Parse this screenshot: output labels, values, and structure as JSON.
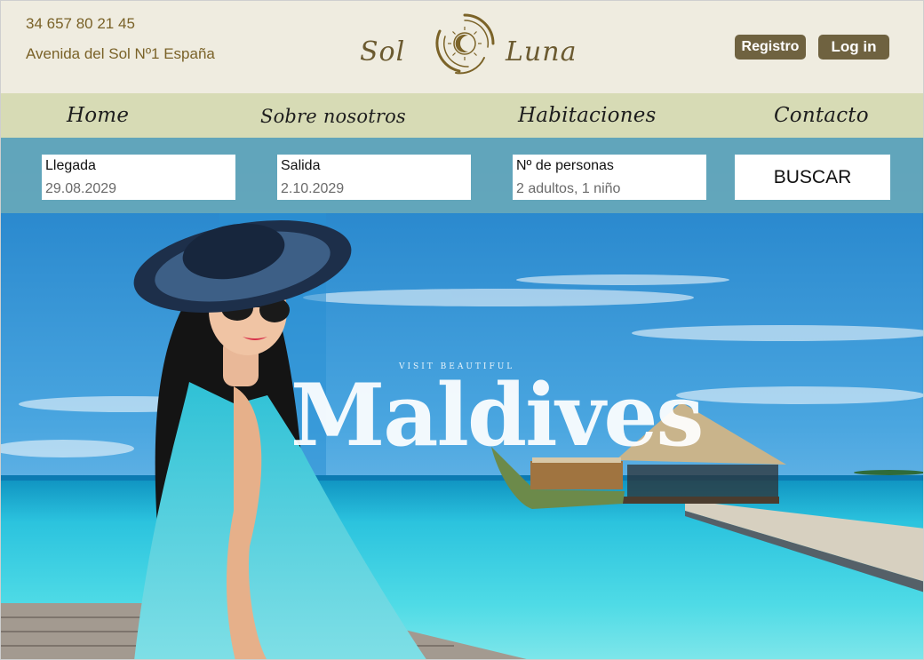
{
  "header": {
    "phone": "34 657 80 21 45",
    "address": "Avenida del Sol Nº1 España",
    "logo_left": "Sol",
    "logo_right": "Luna",
    "register_label": "Registro",
    "login_label": "Log in"
  },
  "nav": {
    "items": [
      {
        "label": "Home"
      },
      {
        "label": "Sobre nosotros"
      },
      {
        "label": "Habitaciones"
      },
      {
        "label": "Contacto"
      }
    ]
  },
  "booking": {
    "arrival_label": "Llegada",
    "arrival_value": "29.08.2029",
    "departure_label": "Salida",
    "departure_value": "2.10.2029",
    "guests_label": "Nº de personas",
    "guests_value": "2 adultos, 1 niño",
    "search_label": "BUSCAR"
  },
  "hero": {
    "kicker": "VISIT BEAUTIFUL",
    "title": "Maldives"
  },
  "colors": {
    "header_bg": "#efece0",
    "nav_bg": "#d7dbb5",
    "accent_brown": "#6f6240",
    "text_gold": "#7a6228",
    "booking_bar": "#67a8ba"
  }
}
